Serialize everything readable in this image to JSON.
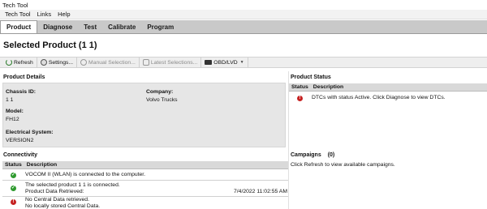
{
  "window": {
    "title": "Tech Tool"
  },
  "menu": [
    "Tech Tool",
    "Links",
    "Help"
  ],
  "tabs": [
    "Product",
    "Diagnose",
    "Test",
    "Calibrate",
    "Program"
  ],
  "page_title": "Selected Product (1 1)",
  "toolbar": {
    "refresh": "Refresh",
    "settings": "Settings...",
    "manual": "Manual Selection...",
    "latest": "Latest Selections...",
    "obd": "OBD/LVD"
  },
  "product_details": {
    "heading": "Product Details",
    "chassis_label": "Chassis ID:",
    "chassis_value": "1 1",
    "company_label": "Company:",
    "company_value": "Volvo Trucks",
    "model_label": "Model:",
    "model_value": "FH12",
    "electrical_label": "Electrical System:",
    "electrical_value": "VERSION2"
  },
  "product_status": {
    "heading": "Product Status",
    "col_status": "Status",
    "col_description": "Description",
    "rows": [
      {
        "status": "error",
        "description": "DTCs with status Active. Click Diagnose to view DTCs."
      }
    ]
  },
  "connectivity": {
    "heading": "Connectivity",
    "col_status": "Status",
    "col_description": "Description",
    "rows": [
      {
        "status": "ok",
        "line1": "VOCOM II (WLAN) is connected to the computer.",
        "line2": "",
        "time": ""
      },
      {
        "status": "ok",
        "line1": "The selected product 1 1 is connected.",
        "line2": "Product Data Retrieved:",
        "time": "7/4/2022 11:02:55 AM"
      },
      {
        "status": "error",
        "line1": "No Central Data retrieved.",
        "line2": "No locally stored Central Data.",
        "time": ""
      }
    ]
  },
  "campaigns": {
    "heading": "Campaigns",
    "count": "(0)",
    "message": "Click Refresh to view available campaigns."
  },
  "colors": {
    "ok": "#2e9a2e",
    "error": "#c62222",
    "tabbar": "#c9c9c9"
  }
}
